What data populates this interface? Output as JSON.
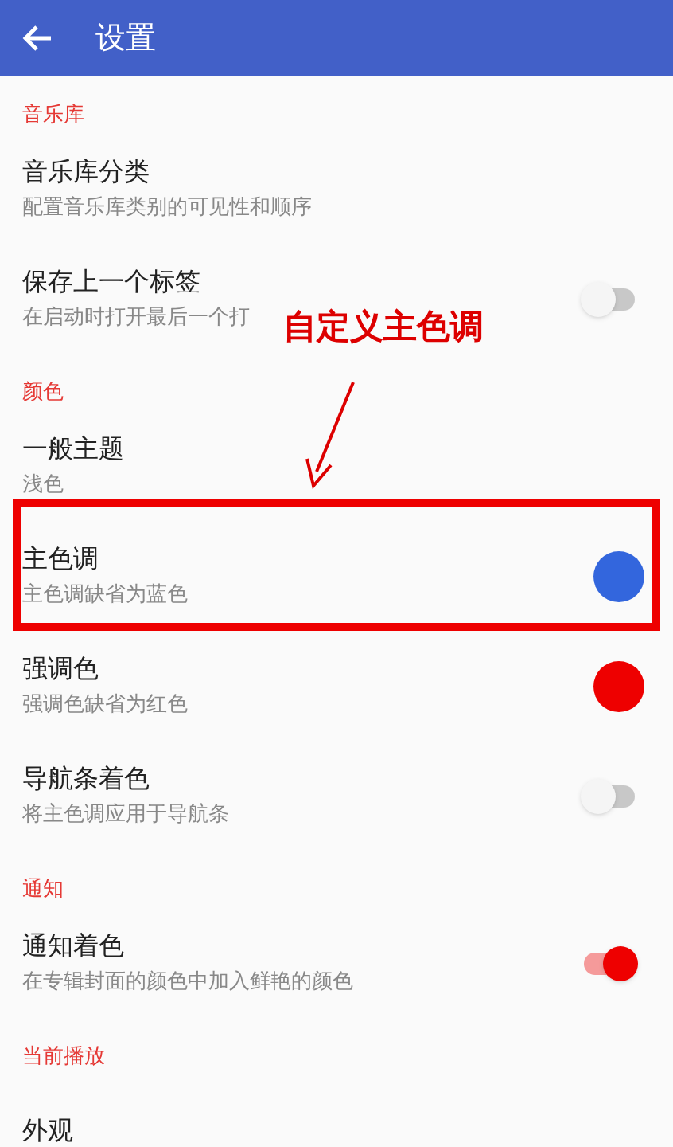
{
  "app_bar": {
    "title": "设置"
  },
  "sections": [
    {
      "header": "音乐库",
      "items": [
        {
          "kind": "plain",
          "title": "音乐库分类",
          "subtitle": "配置音乐库类别的可见性和顺序"
        },
        {
          "kind": "toggle",
          "title": "保存上一个标签",
          "subtitle": "在启动时打开最后一个打",
          "on": false
        }
      ]
    },
    {
      "header": "颜色",
      "items": [
        {
          "kind": "plain",
          "title": "一般主题",
          "subtitle": "浅色"
        },
        {
          "kind": "color",
          "title": "主色调",
          "subtitle": "主色调缺省为蓝色",
          "color": "#3366dd",
          "highlighted": true
        },
        {
          "kind": "color",
          "title": "强调色",
          "subtitle": "强调色缺省为红色",
          "color": "#ee0000",
          "highlighted": false
        },
        {
          "kind": "toggle",
          "title": "导航条着色",
          "subtitle": "将主色调应用于导航条",
          "on": false
        }
      ]
    },
    {
      "header": "通知",
      "items": [
        {
          "kind": "toggle",
          "title": "通知着色",
          "subtitle": "在专辑封面的颜色中加入鲜艳的颜色",
          "on": true
        }
      ]
    },
    {
      "header": "当前播放",
      "items": [
        {
          "kind": "plain",
          "title": "外观"
        }
      ]
    }
  ],
  "annotation": {
    "label": "自定义主色调"
  }
}
